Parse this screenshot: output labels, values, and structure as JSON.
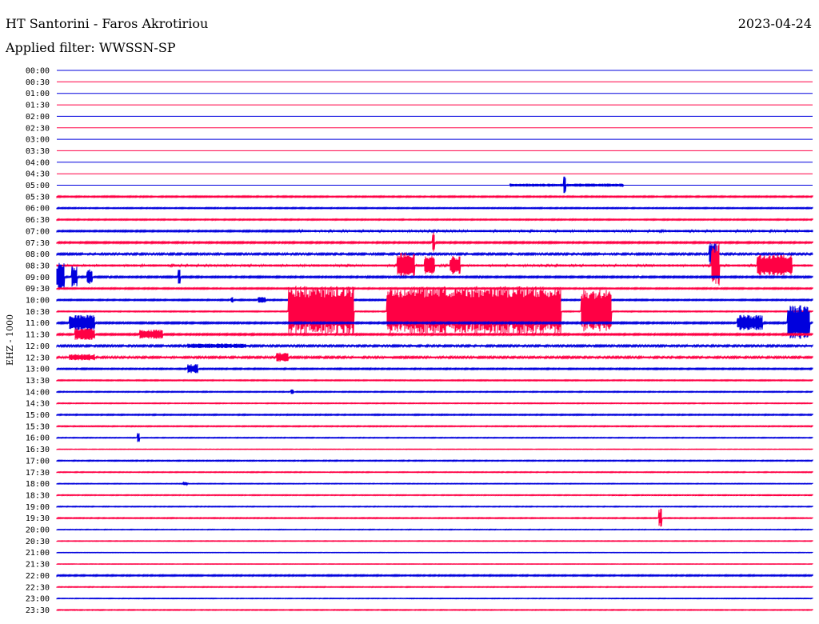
{
  "header": {
    "station": "HT Santorini - Faros Akrotiriou",
    "date": "2023-04-24",
    "filter_label": "Applied filter:",
    "filter_value": "WWSSN-SP"
  },
  "chart_data": {
    "type": "line",
    "title": "HT Santorini - Faros Akrotiriou",
    "ylabel": "EHZ - 1000",
    "xlabel": "",
    "xlim_minutes": [
      0,
      30
    ],
    "colors": {
      "even_rows": "#0000dd",
      "odd_rows": "#ff0044"
    },
    "rows": [
      {
        "label": "00:00",
        "noise": 0.0,
        "bursts": []
      },
      {
        "label": "00:30",
        "noise": 0.0,
        "bursts": []
      },
      {
        "label": "01:00",
        "noise": 0.0,
        "bursts": []
      },
      {
        "label": "01:30",
        "noise": 0.0,
        "bursts": []
      },
      {
        "label": "02:00",
        "noise": 0.0,
        "bursts": []
      },
      {
        "label": "02:30",
        "noise": 0.0,
        "bursts": []
      },
      {
        "label": "03:00",
        "noise": 0.0,
        "bursts": []
      },
      {
        "label": "03:30",
        "noise": 0.0,
        "bursts": []
      },
      {
        "label": "04:00",
        "noise": 0.0,
        "bursts": []
      },
      {
        "label": "04:30",
        "noise": 0.0,
        "bursts": []
      },
      {
        "label": "05:00",
        "noise": 0.0,
        "bursts": [
          [
            18.0,
            22.5,
            2
          ],
          [
            20.1,
            20.2,
            16
          ]
        ]
      },
      {
        "label": "05:30",
        "noise": 0.8,
        "bursts": []
      },
      {
        "label": "06:00",
        "noise": 0.7,
        "bursts": []
      },
      {
        "label": "06:30",
        "noise": 0.7,
        "bursts": []
      },
      {
        "label": "07:00",
        "noise": 0.9,
        "bursts": [
          [
            9.6,
            30,
            1.5
          ]
        ]
      },
      {
        "label": "07:30",
        "noise": 1.0,
        "bursts": [
          [
            14.9,
            15.0,
            16
          ]
        ]
      },
      {
        "label": "08:00",
        "noise": 1.2,
        "bursts": [
          [
            25.9,
            26.2,
            14
          ]
        ]
      },
      {
        "label": "08:30",
        "noise": 1.5,
        "bursts": [
          [
            13.5,
            14.2,
            16
          ],
          [
            14.6,
            15.0,
            12
          ],
          [
            15.6,
            16.0,
            12
          ],
          [
            26.0,
            26.3,
            28
          ],
          [
            27.8,
            29.2,
            14
          ]
        ]
      },
      {
        "label": "09:00",
        "noise": 1.0,
        "bursts": [
          [
            0.0,
            0.3,
            18
          ],
          [
            0.6,
            0.8,
            14
          ],
          [
            1.2,
            1.4,
            10
          ],
          [
            4.8,
            4.9,
            10
          ]
        ]
      },
      {
        "label": "09:30",
        "noise": 0.8,
        "bursts": []
      },
      {
        "label": "10:00",
        "noise": 0.8,
        "bursts": [
          [
            6.9,
            7.0,
            4
          ],
          [
            8.0,
            8.3,
            4
          ]
        ]
      },
      {
        "label": "10:30",
        "noise": 0.6,
        "bursts": [
          [
            9.2,
            11.8,
            32
          ],
          [
            13.1,
            20.0,
            32
          ],
          [
            20.8,
            22.0,
            28
          ]
        ]
      },
      {
        "label": "11:00",
        "noise": 1.0,
        "bursts": [
          [
            0.5,
            1.5,
            10
          ],
          [
            27.0,
            28.0,
            10
          ],
          [
            29.0,
            29.9,
            22
          ]
        ]
      },
      {
        "label": "11:30",
        "noise": 1.0,
        "bursts": [
          [
            0.7,
            1.5,
            8
          ],
          [
            3.3,
            4.2,
            6
          ]
        ]
      },
      {
        "label": "12:00",
        "noise": 1.2,
        "bursts": [
          [
            5.2,
            7.5,
            3
          ]
        ]
      },
      {
        "label": "12:30",
        "noise": 1.2,
        "bursts": [
          [
            0.5,
            1.5,
            4
          ],
          [
            8.7,
            9.2,
            6
          ]
        ]
      },
      {
        "label": "13:00",
        "noise": 0.8,
        "bursts": [
          [
            5.2,
            5.6,
            6
          ]
        ]
      },
      {
        "label": "13:30",
        "noise": 0.6,
        "bursts": []
      },
      {
        "label": "14:00",
        "noise": 0.6,
        "bursts": [
          [
            9.3,
            9.4,
            3
          ]
        ]
      },
      {
        "label": "14:30",
        "noise": 0.5,
        "bursts": []
      },
      {
        "label": "15:00",
        "noise": 0.7,
        "bursts": []
      },
      {
        "label": "15:30",
        "noise": 0.6,
        "bursts": []
      },
      {
        "label": "16:00",
        "noise": 0.5,
        "bursts": [
          [
            3.2,
            3.3,
            7
          ]
        ]
      },
      {
        "label": "16:30",
        "noise": 0.3,
        "bursts": []
      },
      {
        "label": "17:00",
        "noise": 0.6,
        "bursts": []
      },
      {
        "label": "17:30",
        "noise": 0.5,
        "bursts": []
      },
      {
        "label": "18:00",
        "noise": 0.4,
        "bursts": [
          [
            5.0,
            5.2,
            2
          ]
        ]
      },
      {
        "label": "18:30",
        "noise": 0.5,
        "bursts": []
      },
      {
        "label": "19:00",
        "noise": 0.5,
        "bursts": []
      },
      {
        "label": "19:30",
        "noise": 0.6,
        "bursts": [
          [
            23.9,
            24.0,
            12
          ]
        ]
      },
      {
        "label": "20:00",
        "noise": 0.4,
        "bursts": []
      },
      {
        "label": "20:30",
        "noise": 0.4,
        "bursts": []
      },
      {
        "label": "21:00",
        "noise": 0.3,
        "bursts": []
      },
      {
        "label": "21:30",
        "noise": 0.3,
        "bursts": []
      },
      {
        "label": "22:00",
        "noise": 0.8,
        "bursts": []
      },
      {
        "label": "22:30",
        "noise": 0.5,
        "bursts": []
      },
      {
        "label": "23:00",
        "noise": 0.4,
        "bursts": []
      },
      {
        "label": "23:30",
        "noise": 0.5,
        "bursts": []
      }
    ]
  }
}
